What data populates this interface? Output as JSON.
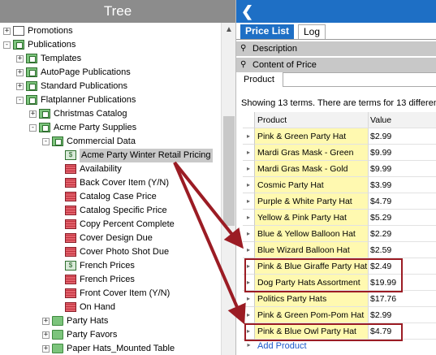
{
  "tree": {
    "title": "Tree",
    "items": [
      {
        "label": "Promotions",
        "indent": 1,
        "exp": "+",
        "icon": "plain"
      },
      {
        "label": "Publications",
        "indent": 1,
        "exp": "-",
        "icon": "folder-doc"
      },
      {
        "label": "Templates",
        "indent": 2,
        "exp": "+",
        "icon": "folder-doc"
      },
      {
        "label": "AutoPage Publications",
        "indent": 2,
        "exp": "+",
        "icon": "folder-doc"
      },
      {
        "label": "Standard Publications",
        "indent": 2,
        "exp": "+",
        "icon": "folder-doc"
      },
      {
        "label": "Flatplanner Publications",
        "indent": 2,
        "exp": "-",
        "icon": "folder-doc"
      },
      {
        "label": "Christmas Catalog",
        "indent": 3,
        "exp": "+",
        "icon": "folder-doc"
      },
      {
        "label": "Acme Party Supplies",
        "indent": 3,
        "exp": "-",
        "icon": "folder-doc"
      },
      {
        "label": "Commercial Data",
        "indent": 4,
        "exp": "-",
        "icon": "folder-doc"
      },
      {
        "label": "Acme Party Winter Retail Pricing",
        "indent": 5,
        "exp": "",
        "icon": "attr-green",
        "selected": true
      },
      {
        "label": "Availability",
        "indent": 5,
        "exp": "",
        "icon": "attr-red"
      },
      {
        "label": "Back Cover Item (Y/N)",
        "indent": 5,
        "exp": "",
        "icon": "attr-red"
      },
      {
        "label": "Catalog Case Price",
        "indent": 5,
        "exp": "",
        "icon": "attr-red"
      },
      {
        "label": "Catalog Specific Price",
        "indent": 5,
        "exp": "",
        "icon": "attr-red"
      },
      {
        "label": "Copy Percent Complete",
        "indent": 5,
        "exp": "",
        "icon": "attr-red"
      },
      {
        "label": "Cover Design Due",
        "indent": 5,
        "exp": "",
        "icon": "attr-red"
      },
      {
        "label": "Cover Photo Shot Due",
        "indent": 5,
        "exp": "",
        "icon": "attr-red"
      },
      {
        "label": "French Prices",
        "indent": 5,
        "exp": "",
        "icon": "attr-green"
      },
      {
        "label": "French Prices",
        "indent": 5,
        "exp": "",
        "icon": "attr-red"
      },
      {
        "label": "Front Cover Item (Y/N)",
        "indent": 5,
        "exp": "",
        "icon": "attr-red"
      },
      {
        "label": "On Hand",
        "indent": 5,
        "exp": "",
        "icon": "attr-red"
      },
      {
        "label": "Party Hats",
        "indent": 4,
        "exp": "+",
        "icon": "folder"
      },
      {
        "label": "Party Favors",
        "indent": 4,
        "exp": "+",
        "icon": "folder"
      },
      {
        "label": "Paper Hats_Mounted Table",
        "indent": 4,
        "exp": "+",
        "icon": "folder"
      }
    ]
  },
  "right": {
    "tabs": [
      "Price List",
      "Log"
    ],
    "sections": [
      "Description",
      "Content of Price"
    ],
    "product_label": "Product",
    "showing_text": "Showing 13 terms. There are terms for 13 differen",
    "columns": [
      "Product",
      "Value"
    ],
    "rows": [
      {
        "product": "Pink & Green Party Hat",
        "value": "$2.99"
      },
      {
        "product": "Mardi Gras Mask - Green",
        "value": "$9.99"
      },
      {
        "product": "Mardi Gras Mask - Gold",
        "value": "$9.99"
      },
      {
        "product": "Cosmic Party Hat",
        "value": "$3.99"
      },
      {
        "product": "Purple & White Party Hat",
        "value": "$4.79"
      },
      {
        "product": "Yellow & Pink Party Hat",
        "value": "$5.29"
      },
      {
        "product": "Blue & Yellow Balloon Hat",
        "value": "$2.29"
      },
      {
        "product": "Blue Wizard Balloon Hat",
        "value": "$2.59"
      },
      {
        "product": "Pink & Blue Giraffe Party Hat",
        "value": "$2.49"
      },
      {
        "product": "Dog Party Hats Assortment",
        "value": "$19.99"
      },
      {
        "product": "Politics Party Hats",
        "value": "$17.76"
      },
      {
        "product": "Pink & Green Pom-Pom Hat",
        "value": "$2.99"
      },
      {
        "product": "Pink & Blue Owl Party Hat",
        "value": "$4.79"
      }
    ],
    "add_product": "Add Product"
  },
  "colors": {
    "accent": "#1e6fc5",
    "highlight": "#9b1c24",
    "product_cell": "#fff9b0"
  }
}
